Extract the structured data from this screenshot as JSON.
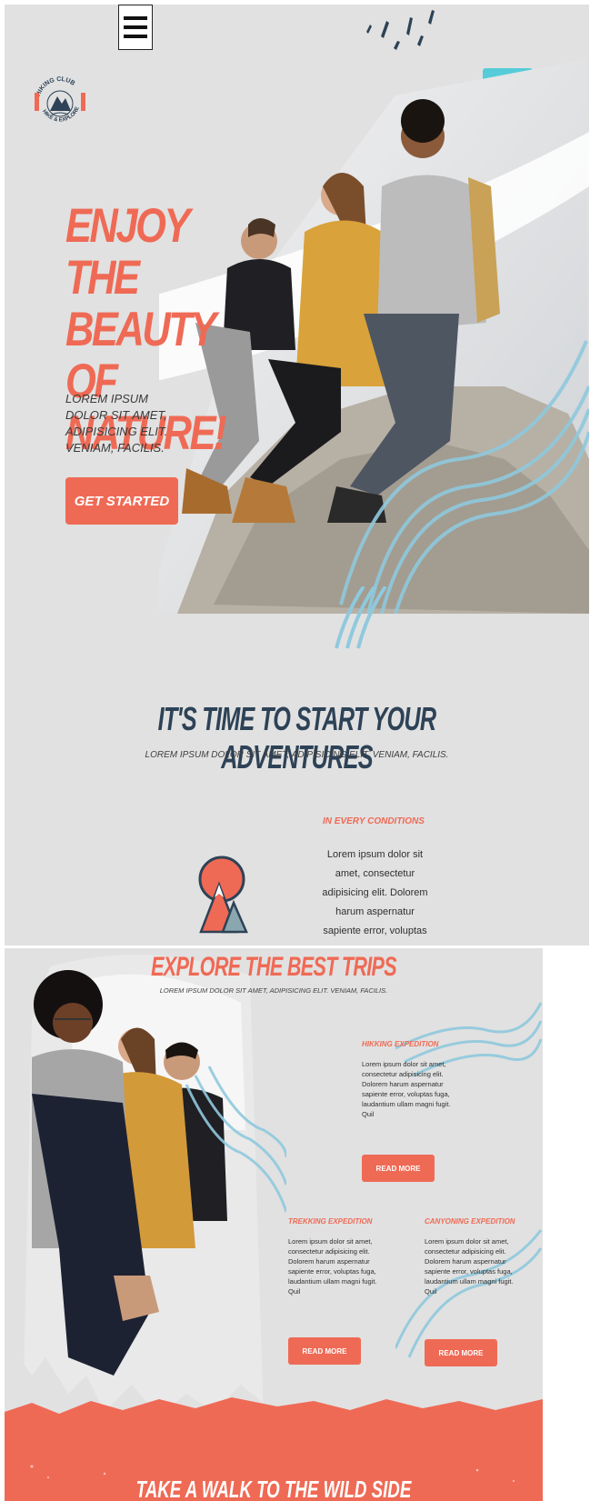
{
  "colors": {
    "accent": "#ef6a55",
    "navy": "#2d4256",
    "teal": "#55ccd8",
    "bg": "#e1e1e1"
  },
  "icons": {
    "menu": "hamburger-menu-icon",
    "search": "search-icon",
    "logo": "hiking-club-logo",
    "mountain": "mountain-icon"
  },
  "logo": {
    "top_text": "HIKING CLUB",
    "bottom_text": "HIKE & EXPLORE"
  },
  "hero": {
    "title": "ENJOY THE BEAUTY OF NATURE!",
    "subtitle": "LOREM IPSUM DOLOR SIT AMET, ADIPISICING ELIT. VENIAM, FACILIS.",
    "cta_label": "GET STARTED"
  },
  "adventures": {
    "title": "IT'S TIME TO START YOUR ADVENTURES",
    "subtitle": "LOREM IPSUM DOLOR SIT AMET, ADIPISICING ELIT. VENIAM, FACILIS.",
    "feature": {
      "title": "IN EVERY CONDITIONS",
      "text": "Lorem ipsum dolor sit amet, consectetur adipisicing elit. Dolorem harum aspernatur sapiente error, voluptas fuga, laudantium ullam"
    }
  },
  "trips": {
    "title": "EXPLORE THE BEST TRIPS",
    "subtitle": "LOREM IPSUM DOLOR SIT AMET, ADIPISICING ELIT. VENIAM, FACILIS.",
    "items": [
      {
        "title": "HIKKING EXPEDITION",
        "text": "Lorem ipsum dolor sit amet, consectetur adipisicing elit. Dolorem harum aspernatur sapiente error, voluptas fuga, laudantium ullam magni fugit. Quil",
        "button": "READ MORE"
      },
      {
        "title": "TREKKING EXPEDITION",
        "text": "Lorem ipsum dolor sit amet, consectetur adipisicing elit. Dolorem harum aspernatur sapiente error, voluptas fuga, laudantium ullam magni fugit. Quil",
        "button": "READ MORE"
      },
      {
        "title": "CANYONING EXPEDITION",
        "text": "Lorem ipsum dolor sit amet, consectetur adipisicing elit. Dolorem harum aspernatur sapiente error, voluptas fuga, laudantium ullam magni fugit. Quil",
        "button": "READ MORE"
      }
    ]
  },
  "footer": {
    "title": "TAKE A WALK TO THE WILD SIDE"
  }
}
